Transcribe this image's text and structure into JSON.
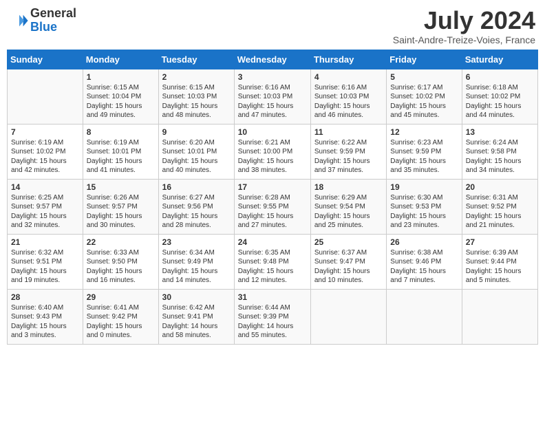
{
  "header": {
    "logo_line1": "General",
    "logo_line2": "Blue",
    "month": "July 2024",
    "location": "Saint-Andre-Treize-Voies, France"
  },
  "days_of_week": [
    "Sunday",
    "Monday",
    "Tuesday",
    "Wednesday",
    "Thursday",
    "Friday",
    "Saturday"
  ],
  "weeks": [
    [
      {
        "day": "",
        "sunrise": "",
        "sunset": "",
        "daylight": ""
      },
      {
        "day": "1",
        "sunrise": "6:15 AM",
        "sunset": "10:04 PM",
        "daylight": "15 hours and 49 minutes."
      },
      {
        "day": "2",
        "sunrise": "6:15 AM",
        "sunset": "10:03 PM",
        "daylight": "15 hours and 48 minutes."
      },
      {
        "day": "3",
        "sunrise": "6:16 AM",
        "sunset": "10:03 PM",
        "daylight": "15 hours and 47 minutes."
      },
      {
        "day": "4",
        "sunrise": "6:16 AM",
        "sunset": "10:03 PM",
        "daylight": "15 hours and 46 minutes."
      },
      {
        "day": "5",
        "sunrise": "6:17 AM",
        "sunset": "10:02 PM",
        "daylight": "15 hours and 45 minutes."
      },
      {
        "day": "6",
        "sunrise": "6:18 AM",
        "sunset": "10:02 PM",
        "daylight": "15 hours and 44 minutes."
      }
    ],
    [
      {
        "day": "7",
        "sunrise": "6:19 AM",
        "sunset": "10:02 PM",
        "daylight": "15 hours and 42 minutes."
      },
      {
        "day": "8",
        "sunrise": "6:19 AM",
        "sunset": "10:01 PM",
        "daylight": "15 hours and 41 minutes."
      },
      {
        "day": "9",
        "sunrise": "6:20 AM",
        "sunset": "10:01 PM",
        "daylight": "15 hours and 40 minutes."
      },
      {
        "day": "10",
        "sunrise": "6:21 AM",
        "sunset": "10:00 PM",
        "daylight": "15 hours and 38 minutes."
      },
      {
        "day": "11",
        "sunrise": "6:22 AM",
        "sunset": "9:59 PM",
        "daylight": "15 hours and 37 minutes."
      },
      {
        "day": "12",
        "sunrise": "6:23 AM",
        "sunset": "9:59 PM",
        "daylight": "15 hours and 35 minutes."
      },
      {
        "day": "13",
        "sunrise": "6:24 AM",
        "sunset": "9:58 PM",
        "daylight": "15 hours and 34 minutes."
      }
    ],
    [
      {
        "day": "14",
        "sunrise": "6:25 AM",
        "sunset": "9:57 PM",
        "daylight": "15 hours and 32 minutes."
      },
      {
        "day": "15",
        "sunrise": "6:26 AM",
        "sunset": "9:57 PM",
        "daylight": "15 hours and 30 minutes."
      },
      {
        "day": "16",
        "sunrise": "6:27 AM",
        "sunset": "9:56 PM",
        "daylight": "15 hours and 28 minutes."
      },
      {
        "day": "17",
        "sunrise": "6:28 AM",
        "sunset": "9:55 PM",
        "daylight": "15 hours and 27 minutes."
      },
      {
        "day": "18",
        "sunrise": "6:29 AM",
        "sunset": "9:54 PM",
        "daylight": "15 hours and 25 minutes."
      },
      {
        "day": "19",
        "sunrise": "6:30 AM",
        "sunset": "9:53 PM",
        "daylight": "15 hours and 23 minutes."
      },
      {
        "day": "20",
        "sunrise": "6:31 AM",
        "sunset": "9:52 PM",
        "daylight": "15 hours and 21 minutes."
      }
    ],
    [
      {
        "day": "21",
        "sunrise": "6:32 AM",
        "sunset": "9:51 PM",
        "daylight": "15 hours and 19 minutes."
      },
      {
        "day": "22",
        "sunrise": "6:33 AM",
        "sunset": "9:50 PM",
        "daylight": "15 hours and 16 minutes."
      },
      {
        "day": "23",
        "sunrise": "6:34 AM",
        "sunset": "9:49 PM",
        "daylight": "15 hours and 14 minutes."
      },
      {
        "day": "24",
        "sunrise": "6:35 AM",
        "sunset": "9:48 PM",
        "daylight": "15 hours and 12 minutes."
      },
      {
        "day": "25",
        "sunrise": "6:37 AM",
        "sunset": "9:47 PM",
        "daylight": "15 hours and 10 minutes."
      },
      {
        "day": "26",
        "sunrise": "6:38 AM",
        "sunset": "9:46 PM",
        "daylight": "15 hours and 7 minutes."
      },
      {
        "day": "27",
        "sunrise": "6:39 AM",
        "sunset": "9:44 PM",
        "daylight": "15 hours and 5 minutes."
      }
    ],
    [
      {
        "day": "28",
        "sunrise": "6:40 AM",
        "sunset": "9:43 PM",
        "daylight": "15 hours and 3 minutes."
      },
      {
        "day": "29",
        "sunrise": "6:41 AM",
        "sunset": "9:42 PM",
        "daylight": "15 hours and 0 minutes."
      },
      {
        "day": "30",
        "sunrise": "6:42 AM",
        "sunset": "9:41 PM",
        "daylight": "14 hours and 58 minutes."
      },
      {
        "day": "31",
        "sunrise": "6:44 AM",
        "sunset": "9:39 PM",
        "daylight": "14 hours and 55 minutes."
      },
      {
        "day": "",
        "sunrise": "",
        "sunset": "",
        "daylight": ""
      },
      {
        "day": "",
        "sunrise": "",
        "sunset": "",
        "daylight": ""
      },
      {
        "day": "",
        "sunrise": "",
        "sunset": "",
        "daylight": ""
      }
    ]
  ]
}
